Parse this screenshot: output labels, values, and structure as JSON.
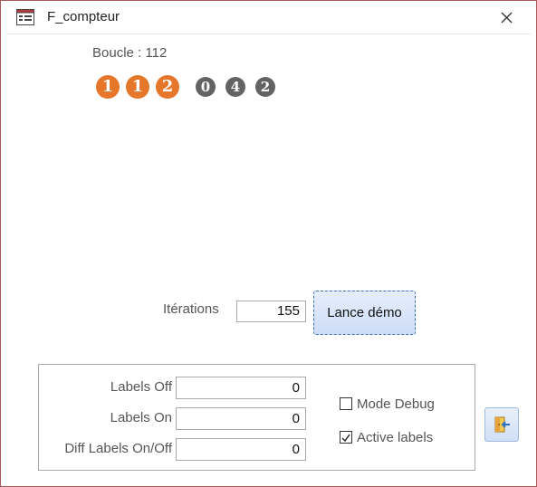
{
  "window": {
    "title": "F_compteur",
    "app_icon": "form-icon",
    "close_icon": "close-icon"
  },
  "counter": {
    "boucle_text": "Boucle : 112",
    "digits_orange": [
      "1",
      "1",
      "2"
    ],
    "digits_gray": [
      "0",
      "4",
      "2"
    ],
    "orange_color": "#e5762a",
    "gray_color": "#636363"
  },
  "iterations": {
    "label": "Itérations",
    "value": "155"
  },
  "demo_button": {
    "label": "Lance démo"
  },
  "labels_panel": {
    "labels_off": {
      "label": "Labels Off",
      "value": "0"
    },
    "labels_on": {
      "label": "Labels On",
      "value": "0"
    },
    "diff": {
      "label": "Diff Labels On/Off",
      "value": "0"
    }
  },
  "options": {
    "mode_debug": {
      "label": "Mode Debug",
      "checked": false
    },
    "active_labels": {
      "label": "Active labels",
      "checked": true
    }
  },
  "exit_button": {
    "icon": "exit-door-icon"
  }
}
